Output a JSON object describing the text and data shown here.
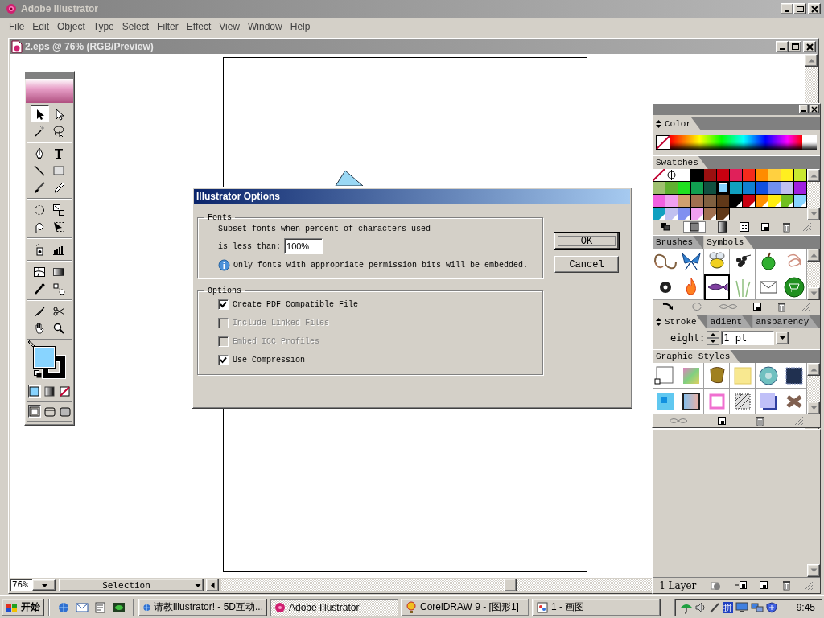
{
  "app": {
    "title": "Adobe Illustrator"
  },
  "menu": [
    "File",
    "Edit",
    "Object",
    "Type",
    "Select",
    "Filter",
    "Effect",
    "View",
    "Window",
    "Help"
  ],
  "document": {
    "title": "2.eps @ 76% (RGB/Preview)",
    "zoom": "76%",
    "status": "Selection"
  },
  "toolbox": {
    "tool_groups": [
      {
        "tools": [
          {
            "kind": "selection",
            "selected": true
          },
          {
            "kind": "direct-selection",
            "selected": false
          },
          {
            "kind": "magic-wand",
            "selected": false
          },
          {
            "kind": "lasso",
            "selected": false
          }
        ]
      },
      {
        "tools": [
          {
            "kind": "pen",
            "selected": false
          },
          {
            "kind": "type",
            "selected": false
          },
          {
            "kind": "line",
            "selected": false
          },
          {
            "kind": "rectangle",
            "selected": false
          },
          {
            "kind": "paintbrush",
            "selected": false
          },
          {
            "kind": "pencil",
            "selected": false
          }
        ]
      },
      {
        "tools": [
          {
            "kind": "rotate",
            "selected": false
          },
          {
            "kind": "scale",
            "selected": false
          },
          {
            "kind": "warp",
            "selected": false
          },
          {
            "kind": "free-transform",
            "selected": false
          }
        ]
      },
      {
        "tools": [
          {
            "kind": "symbol-sprayer",
            "selected": false
          },
          {
            "kind": "graph",
            "selected": false
          }
        ]
      },
      {
        "tools": [
          {
            "kind": "mesh",
            "selected": false
          },
          {
            "kind": "gradient",
            "selected": false
          },
          {
            "kind": "eyedropper",
            "selected": false
          },
          {
            "kind": "blend",
            "selected": false
          }
        ]
      },
      {
        "tools": [
          {
            "kind": "knife",
            "selected": false
          },
          {
            "kind": "scissors",
            "selected": false
          },
          {
            "kind": "hand",
            "selected": false
          },
          {
            "kind": "zoom",
            "selected": false
          }
        ]
      }
    ],
    "paint_swatches": [
      {
        "kind": "fill",
        "color": "#88d4ff"
      },
      {
        "kind": "stroke",
        "color": "#000000"
      }
    ],
    "paint_modes": [
      {
        "kind": "color",
        "selected": true
      },
      {
        "kind": "gradient",
        "selected": false
      },
      {
        "kind": "none",
        "selected": false
      }
    ],
    "screen_modes": [
      {
        "kind": "standard",
        "selected": true
      },
      {
        "kind": "full-menu",
        "selected": false
      },
      {
        "kind": "full",
        "selected": false
      }
    ]
  },
  "dialog": {
    "title": "Illustrator Options",
    "fonts_group": {
      "legend": "Fonts",
      "subset_text": "Subset fonts when percent of characters used",
      "less_than_label": "is less than:",
      "percent_value": "100%",
      "info_text": "Only fonts with appropriate permission bits will be embedded."
    },
    "options_group": {
      "legend": "Options",
      "checkboxes": [
        {
          "label": "Create PDF Compatible File",
          "checked": true,
          "disabled": false
        },
        {
          "label": "Include Linked Files",
          "checked": false,
          "disabled": true
        },
        {
          "label": "Embed ICC Profiles",
          "checked": false,
          "disabled": true
        },
        {
          "label": "Use Compression",
          "checked": true,
          "disabled": false
        }
      ]
    },
    "buttons": [
      {
        "label": "OK",
        "default": true
      },
      {
        "label": "Cancel",
        "default": false
      }
    ]
  },
  "palettes": {
    "color": {
      "tab": "Color"
    },
    "swatches": {
      "tab": "Swatches",
      "items": [
        {
          "kind": "none",
          "selected": false
        },
        {
          "kind": "registration",
          "selected": false
        },
        {
          "kind": "color",
          "color": "#ffffff",
          "selected": false
        },
        {
          "kind": "color",
          "color": "#000000",
          "selected": false
        },
        {
          "kind": "color",
          "color": "#9b1010",
          "selected": false
        },
        {
          "kind": "color",
          "color": "#c80010",
          "selected": false
        },
        {
          "kind": "color",
          "color": "#e0205a",
          "selected": false
        },
        {
          "kind": "color",
          "color": "#f52a1c",
          "selected": false
        },
        {
          "kind": "color",
          "color": "#ff8c00",
          "selected": false
        },
        {
          "kind": "color",
          "color": "#ffd040",
          "selected": false
        },
        {
          "kind": "color",
          "color": "#ffee20",
          "selected": false
        },
        {
          "kind": "color",
          "color": "#c8e830",
          "selected": false
        },
        {
          "kind": "color",
          "color": "#a0c070",
          "selected": false
        },
        {
          "kind": "color",
          "color": "#60b030",
          "selected": false
        },
        {
          "kind": "color",
          "color": "#20e020",
          "selected": false
        },
        {
          "kind": "color",
          "color": "#10a050",
          "selected": false
        },
        {
          "kind": "color",
          "color": "#105040",
          "selected": false
        },
        {
          "kind": "color",
          "color": "#88d4ff",
          "selected": true
        },
        {
          "kind": "color",
          "color": "#10a0c0",
          "selected": false
        },
        {
          "kind": "color",
          "color": "#1080d0",
          "selected": false
        },
        {
          "kind": "color",
          "color": "#1050e0",
          "selected": false
        },
        {
          "kind": "color",
          "color": "#7090f0",
          "selected": false
        },
        {
          "kind": "color",
          "color": "#c0c0f0",
          "selected": false
        },
        {
          "kind": "color",
          "color": "#a020e0",
          "selected": false
        },
        {
          "kind": "color",
          "color": "#f060e0",
          "selected": false
        },
        {
          "kind": "color",
          "color": "#f0a0f0",
          "selected": false
        },
        {
          "kind": "color",
          "color": "#d0a070",
          "selected": false
        },
        {
          "kind": "color",
          "color": "#a07050",
          "selected": false
        },
        {
          "kind": "color",
          "color": "#806040",
          "selected": false
        },
        {
          "kind": "color",
          "color": "#603818",
          "selected": false
        },
        {
          "kind": "spot",
          "color": "#000000",
          "selected": false
        },
        {
          "kind": "spot",
          "color": "#c80010",
          "selected": false
        },
        {
          "kind": "spot",
          "color": "#ff9000",
          "selected": false
        },
        {
          "kind": "spot",
          "color": "#ffee10",
          "selected": false
        },
        {
          "kind": "spot",
          "color": "#70c020",
          "selected": false
        },
        {
          "kind": "spot",
          "color": "#88d4ff",
          "selected": false
        },
        {
          "kind": "spot",
          "color": "#10a0c0",
          "selected": false
        },
        {
          "kind": "spot",
          "color": "#c0c0f0",
          "selected": false
        },
        {
          "kind": "spot",
          "color": "#8090f0",
          "selected": false
        },
        {
          "kind": "spot",
          "color": "#f0a0f0",
          "selected": false
        },
        {
          "kind": "spot",
          "color": "#a07050",
          "selected": false
        },
        {
          "kind": "spot",
          "color": "#603818",
          "selected": false
        }
      ]
    },
    "symbol_panel": {
      "tabs": [
        {
          "label": "Brushes",
          "selected": false
        },
        {
          "label": "Symbols",
          "selected": true
        }
      ],
      "symbols": [
        {
          "kind": "scroll",
          "selected": false
        },
        {
          "kind": "butterfly",
          "selected": false
        },
        {
          "kind": "bee",
          "selected": false
        },
        {
          "kind": "grapes",
          "selected": false
        },
        {
          "kind": "apple",
          "selected": false
        },
        {
          "kind": "knot",
          "selected": false
        },
        {
          "kind": "dot",
          "selected": false
        },
        {
          "kind": "flame",
          "selected": false
        },
        {
          "kind": "fish",
          "selected": true
        },
        {
          "kind": "grass",
          "selected": false
        },
        {
          "kind": "envelope",
          "selected": false
        },
        {
          "kind": "cart",
          "selected": false
        }
      ]
    },
    "stroke_panel": {
      "tabs": [
        {
          "label": "Stroke",
          "selected": true
        },
        {
          "label": "adient",
          "selected": false
        },
        {
          "label": "ansparency",
          "selected": false
        }
      ],
      "weight_label": "eight:",
      "weight_value": "1 pt"
    },
    "graphic_styles": {
      "tab": "Graphic Styles",
      "items": [
        {
          "kind": "default"
        },
        {
          "kind": "rainbow"
        },
        {
          "kind": "gold"
        },
        {
          "kind": "note"
        },
        {
          "kind": "disc"
        },
        {
          "kind": "stitch"
        },
        {
          "kind": "tile"
        },
        {
          "kind": "frame"
        },
        {
          "kind": "ring"
        },
        {
          "kind": "hatch"
        },
        {
          "kind": "shadow"
        },
        {
          "kind": "knot"
        }
      ]
    },
    "layers": {
      "count_label": "1 Layer"
    }
  },
  "taskbar": {
    "start_label": "开始",
    "quick_launch": [
      {
        "kind": "browser"
      },
      {
        "kind": "mail"
      },
      {
        "kind": "notepad"
      },
      {
        "kind": "media"
      }
    ],
    "tasks": [
      {
        "label": "请教illustrator! - 5D互动...",
        "kind": "browser",
        "selected": false
      },
      {
        "label": "Adobe Illustrator",
        "kind": "flower",
        "selected": true
      },
      {
        "label": "CorelDRAW 9 - [图形1]",
        "kind": "balloon",
        "selected": false
      },
      {
        "label": "1 - 画图",
        "kind": "paint",
        "selected": false
      }
    ],
    "tray": {
      "ime_label": "拼",
      "clock": "9:45"
    }
  }
}
